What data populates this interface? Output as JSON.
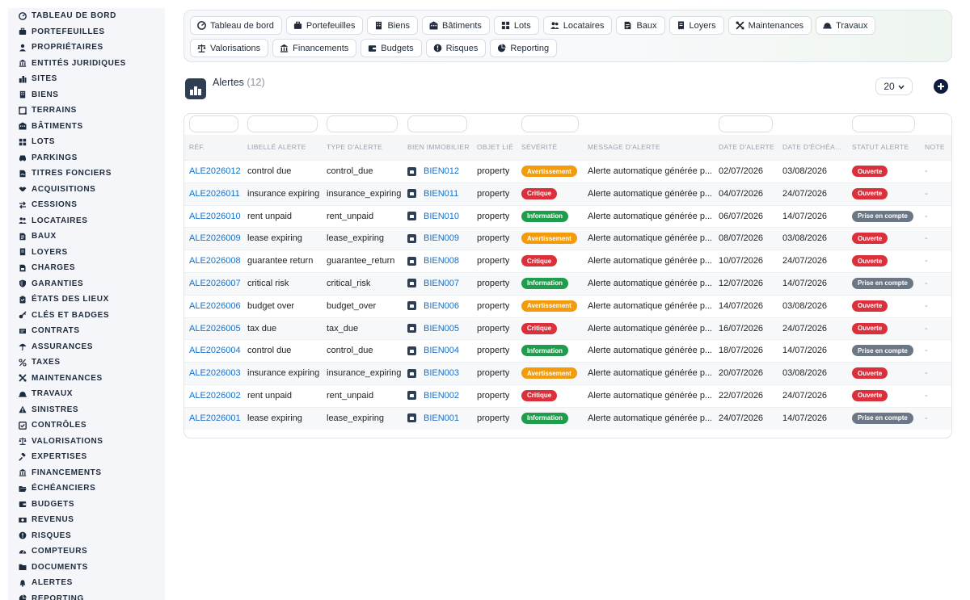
{
  "sidebar": {
    "items": [
      {
        "label": "TABLEAU DE BORD",
        "icon": "dashboard-icon"
      },
      {
        "label": "PORTEFEUILLES",
        "icon": "briefcase-icon"
      },
      {
        "label": "PROPRIÉTAIRES",
        "icon": "user-icon"
      },
      {
        "label": "ENTITÉS JURIDIQUES",
        "icon": "building-columns-icon"
      },
      {
        "label": "SITES",
        "icon": "city-icon"
      },
      {
        "label": "BIENS",
        "icon": "building-icon"
      },
      {
        "label": "TERRAINS",
        "icon": "land-icon"
      },
      {
        "label": "BÂTIMENTS",
        "icon": "buildings-icon"
      },
      {
        "label": "LOTS",
        "icon": "grid-icon"
      },
      {
        "label": "PARKINGS",
        "icon": "car-icon"
      },
      {
        "label": "TITRES FONCIERS",
        "icon": "file-signature-icon"
      },
      {
        "label": "ACQUISITIONS",
        "icon": "handshake-icon"
      },
      {
        "label": "CESSIONS",
        "icon": "exchange-icon"
      },
      {
        "label": "LOCATAIRES",
        "icon": "users-icon"
      },
      {
        "label": "BAUX",
        "icon": "file-contract-icon"
      },
      {
        "label": "LOYERS",
        "icon": "receipt-icon"
      },
      {
        "label": "CHARGES",
        "icon": "file-invoice-icon"
      },
      {
        "label": "GARANTIES",
        "icon": "shield-icon"
      },
      {
        "label": "ÉTATS DES LIEUX",
        "icon": "clipboard-icon"
      },
      {
        "label": "CLÉS ET BADGES",
        "icon": "key-icon"
      },
      {
        "label": "CONTRATS",
        "icon": "contract-icon"
      },
      {
        "label": "ASSURANCES",
        "icon": "umbrella-icon"
      },
      {
        "label": "TAXES",
        "icon": "percent-icon"
      },
      {
        "label": "MAINTENANCES",
        "icon": "tools-icon"
      },
      {
        "label": "TRAVAUX",
        "icon": "hard-hat-icon"
      },
      {
        "label": "SINISTRES",
        "icon": "warning-icon"
      },
      {
        "label": "CONTRÔLES",
        "icon": "check-square-icon"
      },
      {
        "label": "VALORISATIONS",
        "icon": "balance-scale-icon"
      },
      {
        "label": "EXPERTISES",
        "icon": "gavel-icon"
      },
      {
        "label": "FINANCEMENTS",
        "icon": "bank-icon"
      },
      {
        "label": "ÉCHÉANCIERS",
        "icon": "folder-open-icon"
      },
      {
        "label": "BUDGETS",
        "icon": "wallet-icon"
      },
      {
        "label": "REVENUS",
        "icon": "money-bill-icon"
      },
      {
        "label": "RISQUES",
        "icon": "alert-circle-icon"
      },
      {
        "label": "COMPTEURS",
        "icon": "gauge-icon"
      },
      {
        "label": "DOCUMENTS",
        "icon": "folder-icon"
      },
      {
        "label": "ALERTES",
        "icon": "bell-icon"
      },
      {
        "label": "REPORTING",
        "icon": "chart-pie-icon"
      }
    ]
  },
  "tabs": [
    {
      "label": "Tableau de bord",
      "icon": "dashboard-icon"
    },
    {
      "label": "Portefeuilles",
      "icon": "briefcase-icon"
    },
    {
      "label": "Biens",
      "icon": "building-icon"
    },
    {
      "label": "Bâtiments",
      "icon": "buildings-icon"
    },
    {
      "label": "Lots",
      "icon": "grid-icon"
    },
    {
      "label": "Locataires",
      "icon": "users-icon"
    },
    {
      "label": "Baux",
      "icon": "file-contract-icon"
    },
    {
      "label": "Loyers",
      "icon": "receipt-icon"
    },
    {
      "label": "Maintenances",
      "icon": "tools-icon"
    },
    {
      "label": "Travaux",
      "icon": "hard-hat-icon"
    },
    {
      "label": "Valorisations",
      "icon": "balance-scale-icon"
    },
    {
      "label": "Financements",
      "icon": "bank-icon"
    },
    {
      "label": "Budgets",
      "icon": "wallet-icon"
    },
    {
      "label": "Risques",
      "icon": "alert-circle-icon"
    },
    {
      "label": "Reporting",
      "icon": "chart-pie-icon"
    }
  ],
  "header": {
    "title": "Alertes",
    "count": "(12)",
    "per_page": "20"
  },
  "table": {
    "columns": [
      "RÉF.",
      "LIBELLÉ ALERTE",
      "TYPE D'ALERTE",
      "BIEN IMMOBILIER",
      "OBJET LIÉ",
      "SÉVÉRITÉ",
      "MESSAGE D'ALERTE",
      "DATE D'ALERTE",
      "DATE D'ÉCHÉA...",
      "STATUT ALERTE",
      "NOTE"
    ],
    "rows": [
      {
        "ref": "ALE2026012",
        "label": "control due",
        "type": "control_due",
        "bien": "BIEN012",
        "objet": "property",
        "severity": "Avertissement",
        "message": "Alerte automatique générée p...",
        "date_alerte": "02/07/2026",
        "date_echeance": "03/08/2026",
        "statut": "Ouverte",
        "note": "-"
      },
      {
        "ref": "ALE2026011",
        "label": "insurance expiring",
        "type": "insurance_expiring",
        "bien": "BIEN011",
        "objet": "property",
        "severity": "Critique",
        "message": "Alerte automatique générée p...",
        "date_alerte": "04/07/2026",
        "date_echeance": "24/07/2026",
        "statut": "Ouverte",
        "note": "-"
      },
      {
        "ref": "ALE2026010",
        "label": "rent unpaid",
        "type": "rent_unpaid",
        "bien": "BIEN010",
        "objet": "property",
        "severity": "Information",
        "message": "Alerte automatique générée p...",
        "date_alerte": "06/07/2026",
        "date_echeance": "14/07/2026",
        "statut": "Prise en compte",
        "note": "-"
      },
      {
        "ref": "ALE2026009",
        "label": "lease expiring",
        "type": "lease_expiring",
        "bien": "BIEN009",
        "objet": "property",
        "severity": "Avertissement",
        "message": "Alerte automatique générée p...",
        "date_alerte": "08/07/2026",
        "date_echeance": "03/08/2026",
        "statut": "Ouverte",
        "note": "-"
      },
      {
        "ref": "ALE2026008",
        "label": "guarantee return",
        "type": "guarantee_return",
        "bien": "BIEN008",
        "objet": "property",
        "severity": "Critique",
        "message": "Alerte automatique générée p...",
        "date_alerte": "10/07/2026",
        "date_echeance": "24/07/2026",
        "statut": "Ouverte",
        "note": "-"
      },
      {
        "ref": "ALE2026007",
        "label": "critical risk",
        "type": "critical_risk",
        "bien": "BIEN007",
        "objet": "property",
        "severity": "Information",
        "message": "Alerte automatique générée p...",
        "date_alerte": "12/07/2026",
        "date_echeance": "14/07/2026",
        "statut": "Prise en compte",
        "note": "-"
      },
      {
        "ref": "ALE2026006",
        "label": "budget over",
        "type": "budget_over",
        "bien": "BIEN006",
        "objet": "property",
        "severity": "Avertissement",
        "message": "Alerte automatique générée p...",
        "date_alerte": "14/07/2026",
        "date_echeance": "03/08/2026",
        "statut": "Ouverte",
        "note": "-"
      },
      {
        "ref": "ALE2026005",
        "label": "tax due",
        "type": "tax_due",
        "bien": "BIEN005",
        "objet": "property",
        "severity": "Critique",
        "message": "Alerte automatique générée p...",
        "date_alerte": "16/07/2026",
        "date_echeance": "24/07/2026",
        "statut": "Ouverte",
        "note": "-"
      },
      {
        "ref": "ALE2026004",
        "label": "control due",
        "type": "control_due",
        "bien": "BIEN004",
        "objet": "property",
        "severity": "Information",
        "message": "Alerte automatique générée p...",
        "date_alerte": "18/07/2026",
        "date_echeance": "14/07/2026",
        "statut": "Prise en compte",
        "note": "-"
      },
      {
        "ref": "ALE2026003",
        "label": "insurance expiring",
        "type": "insurance_expiring",
        "bien": "BIEN003",
        "objet": "property",
        "severity": "Avertissement",
        "message": "Alerte automatique générée p...",
        "date_alerte": "20/07/2026",
        "date_echeance": "03/08/2026",
        "statut": "Ouverte",
        "note": "-"
      },
      {
        "ref": "ALE2026002",
        "label": "rent unpaid",
        "type": "rent_unpaid",
        "bien": "BIEN002",
        "objet": "property",
        "severity": "Critique",
        "message": "Alerte automatique générée p...",
        "date_alerte": "22/07/2026",
        "date_echeance": "24/07/2026",
        "statut": "Ouverte",
        "note": "-"
      },
      {
        "ref": "ALE2026001",
        "label": "lease expiring",
        "type": "lease_expiring",
        "bien": "BIEN001",
        "objet": "property",
        "severity": "Information",
        "message": "Alerte automatique générée p...",
        "date_alerte": "24/07/2026",
        "date_echeance": "14/07/2026",
        "statut": "Prise en compte",
        "note": "-"
      }
    ]
  },
  "colors": {
    "Avertissement": "#f29b0c",
    "Critique": "#dc2f3c",
    "Information": "#1f9d4c",
    "Ouverte": "#dc2f3c",
    "Prise en compte": "#6b7785",
    "link": "#1a6fc4"
  }
}
